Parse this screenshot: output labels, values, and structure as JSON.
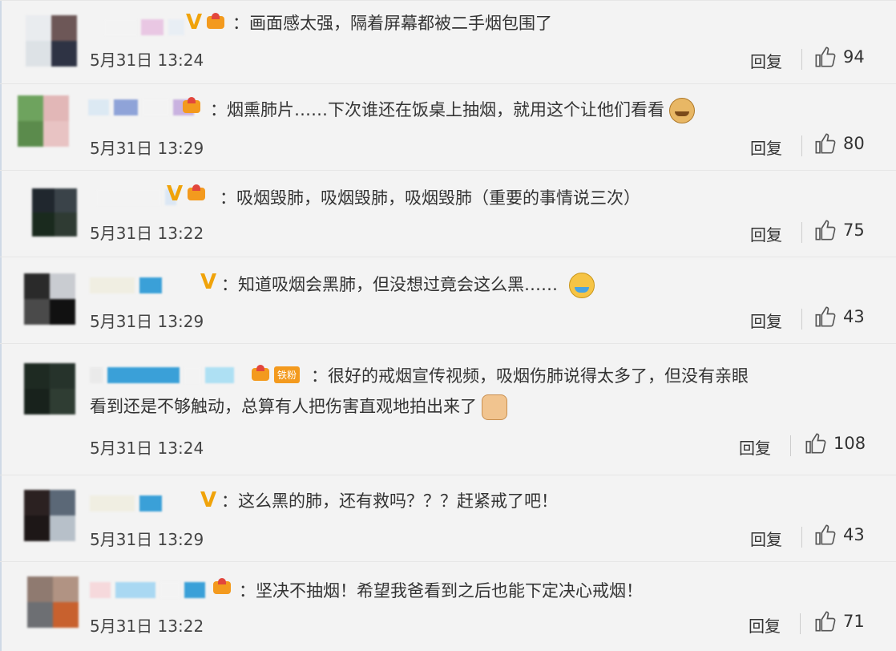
{
  "comments": [
    {
      "text": "：画面感太强，隔着屏幕都被二手烟包围了",
      "time": "5月31日 13:24",
      "reply": "回复",
      "likes": "94"
    },
    {
      "text": "：烟熏肺片……下次谁还在饭桌上抽烟，就用这个让他们看看",
      "time": "5月31日 13:29",
      "reply": "回复",
      "likes": "80"
    },
    {
      "text": "：吸烟毁肺，吸烟毁肺，吸烟毁肺（重要的事情说三次）",
      "time": "5月31日 13:22",
      "reply": "回复",
      "likes": "75"
    },
    {
      "text": "：知道吸烟会黑肺，但没想过竟会这么黑……",
      "time": "5月31日 13:29",
      "reply": "回复",
      "likes": "43"
    },
    {
      "text": "：很好的戒烟宣传视频，吸烟伤肺说得太多了，但没有亲眼",
      "text2": "看到还是不够触动，总算有人把伤害直观地拍出来了",
      "badge": "铁粉",
      "time": "5月31日 13:24",
      "reply": "回复",
      "likes": "108"
    },
    {
      "text": "：这么黑的肺，还有救吗？？？赶紧戒了吧！",
      "time": "5月31日 13:29",
      "reply": "回复",
      "likes": "43"
    },
    {
      "text": "：坚决不抽烟！希望我爸看到之后也能下定决心戒烟！",
      "time": "5月31日 13:22",
      "reply": "回复",
      "likes": "71"
    }
  ],
  "icons": {
    "like": "thumbs-up-icon",
    "verified": "v-badge-icon",
    "vip": "crown-icon"
  },
  "colors": {
    "verified": "#f0a30a",
    "accent": "#f39a1e"
  }
}
